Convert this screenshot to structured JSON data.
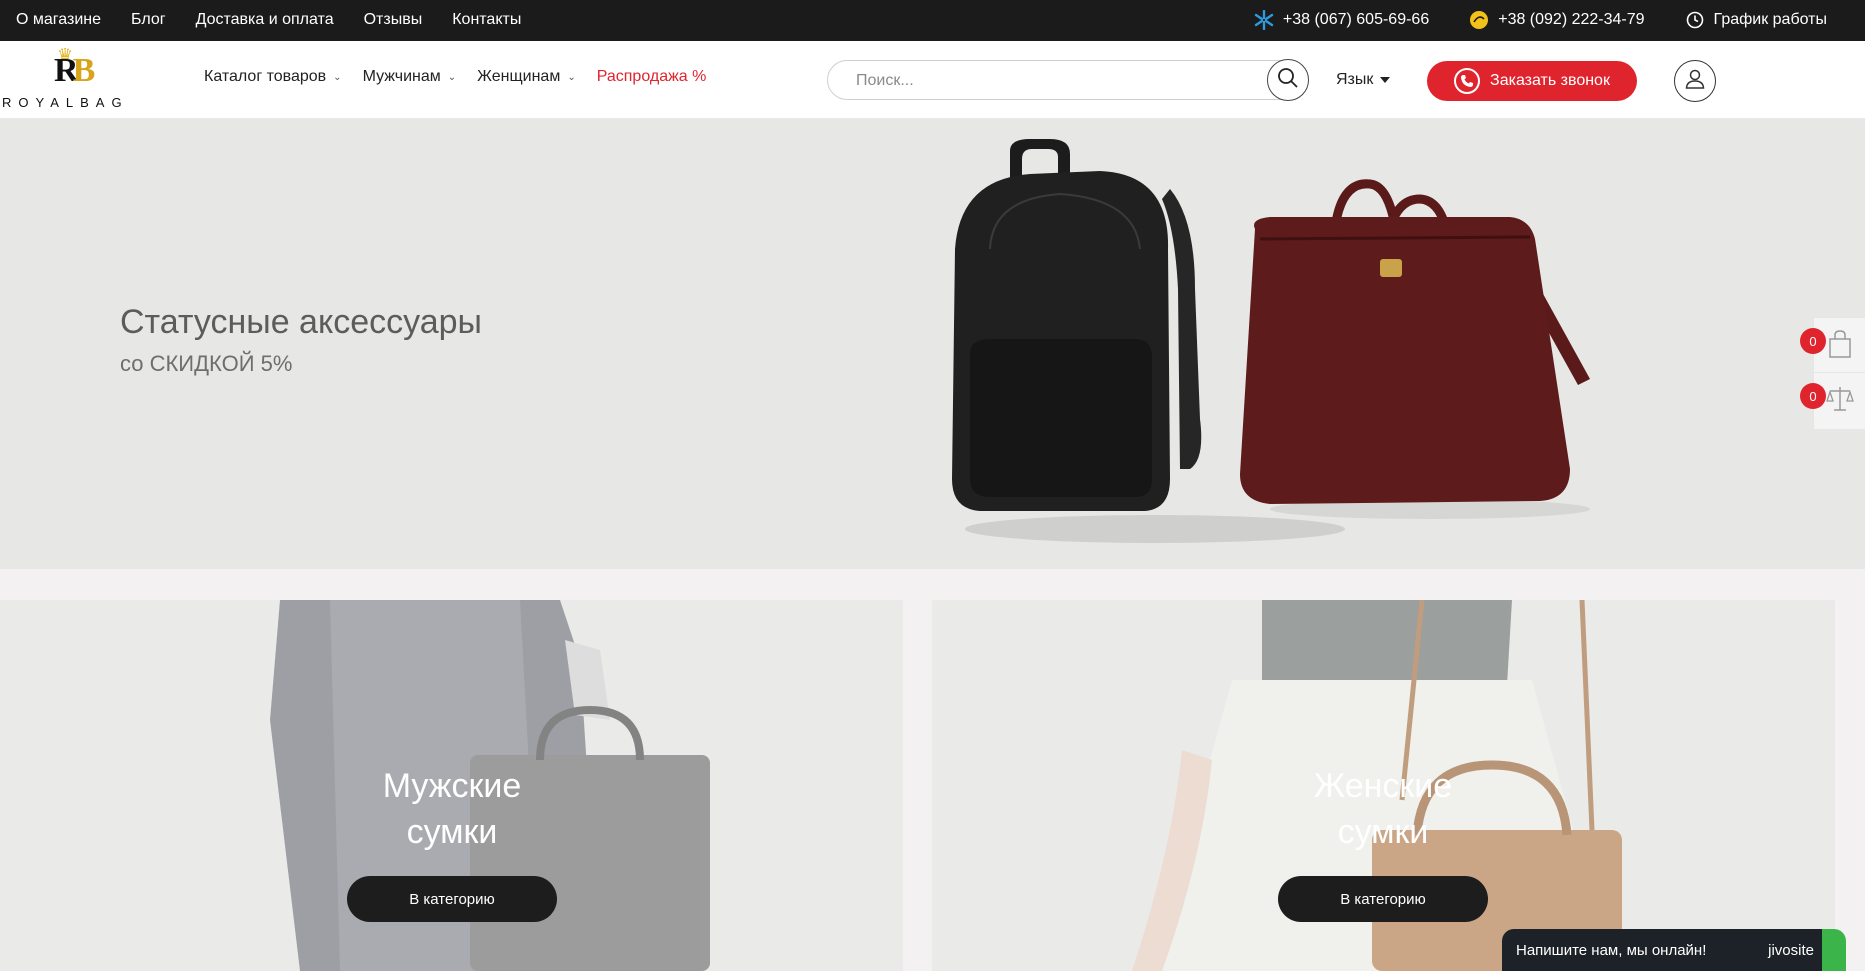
{
  "topbar": {
    "links": [
      "О магазине",
      "Блог",
      "Доставка и оплата",
      "Отзывы",
      "Контакты"
    ],
    "phone1": "+38 (067) 605-69-66",
    "phone2": "+38 (092) 222-34-79",
    "schedule": "График работы"
  },
  "header": {
    "logo_word": "ROYALBAG",
    "logo_letters": [
      "R",
      "B"
    ],
    "nav": [
      {
        "label": "Каталог товаров",
        "has_dropdown": true
      },
      {
        "label": "Мужчинам",
        "has_dropdown": true
      },
      {
        "label": "Женщинам",
        "has_dropdown": true
      },
      {
        "label": "Распродажа %",
        "has_dropdown": false
      }
    ],
    "search_placeholder": "Поиск...",
    "language": "Язык",
    "call_button": "Заказать звонок"
  },
  "hero": {
    "title": "Статусные аксессуары",
    "subtitle": "со СКИДКОЙ 5%"
  },
  "side": {
    "cart_count": "0",
    "compare_count": "0"
  },
  "categories": [
    {
      "title_line1": "Мужские",
      "title_line2": "сумки",
      "button": "В категорию"
    },
    {
      "title_line1": "Женские",
      "title_line2": "сумки",
      "button": "В категорию"
    }
  ],
  "chat": {
    "text": "Напишите нам, мы онлайн!",
    "brand": "jivosite"
  },
  "colors": {
    "accent_red": "#e0242e",
    "topbar_bg": "#1b1b1b",
    "logo_gold": "#d8a51a"
  }
}
